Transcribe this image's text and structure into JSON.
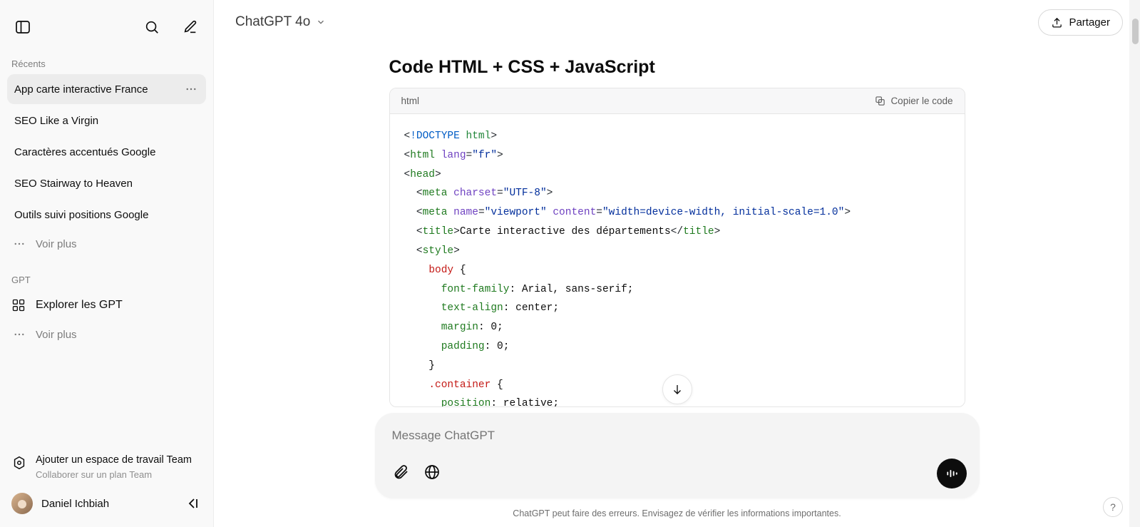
{
  "sidebar": {
    "section_recent": "Récents",
    "items": [
      {
        "label": "App carte interactive France",
        "active": true
      },
      {
        "label": "SEO Like a Virgin",
        "active": false
      },
      {
        "label": "Caractères accentués Google",
        "active": false
      },
      {
        "label": "SEO Stairway to Heaven",
        "active": false
      },
      {
        "label": "Outils suivi positions Google",
        "active": false
      }
    ],
    "see_more": "Voir plus",
    "section_gpt": "GPT",
    "explore_gpt": "Explorer les GPT",
    "team_title": "Ajouter un espace de travail Team",
    "team_sub": "Collaborer sur un plan Team",
    "user_name": "Daniel Ichbiah"
  },
  "header": {
    "model": "ChatGPT 4o",
    "share": "Partager"
  },
  "message": {
    "title": "Code HTML + CSS + JavaScript",
    "code_lang": "html",
    "copy_label": "Copier le code"
  },
  "code_tokens": [
    [
      {
        "t": "t-punct",
        "v": "<"
      },
      {
        "t": "t-doctype-kw",
        "v": "!DOCTYPE"
      },
      {
        "t": "",
        "v": " "
      },
      {
        "t": "t-doctype-name",
        "v": "html"
      },
      {
        "t": "t-punct",
        "v": ">"
      }
    ],
    [
      {
        "t": "t-punct",
        "v": "<"
      },
      {
        "t": "t-tag",
        "v": "html"
      },
      {
        "t": "",
        "v": " "
      },
      {
        "t": "t-attr",
        "v": "lang"
      },
      {
        "t": "t-punct",
        "v": "="
      },
      {
        "t": "t-str",
        "v": "\"fr\""
      },
      {
        "t": "t-punct",
        "v": ">"
      }
    ],
    [
      {
        "t": "t-punct",
        "v": "<"
      },
      {
        "t": "t-tag",
        "v": "head"
      },
      {
        "t": "t-punct",
        "v": ">"
      }
    ],
    [
      {
        "t": "",
        "v": "  "
      },
      {
        "t": "t-punct",
        "v": "<"
      },
      {
        "t": "t-tag",
        "v": "meta"
      },
      {
        "t": "",
        "v": " "
      },
      {
        "t": "t-attr",
        "v": "charset"
      },
      {
        "t": "t-punct",
        "v": "="
      },
      {
        "t": "t-str",
        "v": "\"UTF-8\""
      },
      {
        "t": "t-punct",
        "v": ">"
      }
    ],
    [
      {
        "t": "",
        "v": "  "
      },
      {
        "t": "t-punct",
        "v": "<"
      },
      {
        "t": "t-tag",
        "v": "meta"
      },
      {
        "t": "",
        "v": " "
      },
      {
        "t": "t-attr",
        "v": "name"
      },
      {
        "t": "t-punct",
        "v": "="
      },
      {
        "t": "t-str",
        "v": "\"viewport\""
      },
      {
        "t": "",
        "v": " "
      },
      {
        "t": "t-attr",
        "v": "content"
      },
      {
        "t": "t-punct",
        "v": "="
      },
      {
        "t": "t-str",
        "v": "\"width=device-width, initial-scale=1.0\""
      },
      {
        "t": "t-punct",
        "v": ">"
      }
    ],
    [
      {
        "t": "",
        "v": "  "
      },
      {
        "t": "t-punct",
        "v": "<"
      },
      {
        "t": "t-tag",
        "v": "title"
      },
      {
        "t": "t-punct",
        "v": ">"
      },
      {
        "t": "t-text",
        "v": "Carte interactive des départements"
      },
      {
        "t": "t-punct",
        "v": "</"
      },
      {
        "t": "t-tag",
        "v": "title"
      },
      {
        "t": "t-punct",
        "v": ">"
      }
    ],
    [
      {
        "t": "",
        "v": "  "
      },
      {
        "t": "t-punct",
        "v": "<"
      },
      {
        "t": "t-tag",
        "v": "style"
      },
      {
        "t": "t-punct",
        "v": ">"
      }
    ],
    [
      {
        "t": "",
        "v": "    "
      },
      {
        "t": "t-selector",
        "v": "body"
      },
      {
        "t": "",
        "v": " {"
      }
    ],
    [
      {
        "t": "",
        "v": "      "
      },
      {
        "t": "t-prop",
        "v": "font-family"
      },
      {
        "t": "",
        "v": ": Arial, sans-serif;"
      }
    ],
    [
      {
        "t": "",
        "v": "      "
      },
      {
        "t": "t-prop",
        "v": "text-align"
      },
      {
        "t": "",
        "v": ": center;"
      }
    ],
    [
      {
        "t": "",
        "v": "      "
      },
      {
        "t": "t-prop",
        "v": "margin"
      },
      {
        "t": "",
        "v": ": 0;"
      }
    ],
    [
      {
        "t": "",
        "v": "      "
      },
      {
        "t": "t-prop",
        "v": "padding"
      },
      {
        "t": "",
        "v": ": 0;"
      }
    ],
    [
      {
        "t": "",
        "v": "    }"
      }
    ],
    [
      {
        "t": "",
        "v": "    "
      },
      {
        "t": "t-selector",
        "v": ".container"
      },
      {
        "t": "",
        "v": " {"
      }
    ],
    [
      {
        "t": "",
        "v": "      "
      },
      {
        "t": "t-prop",
        "v": "position"
      },
      {
        "t": "",
        "v": ": relative;"
      }
    ]
  ],
  "composer": {
    "placeholder": "Message ChatGPT"
  },
  "footer": {
    "text": "ChatGPT peut faire des erreurs. Envisagez de vérifier les informations importantes."
  }
}
